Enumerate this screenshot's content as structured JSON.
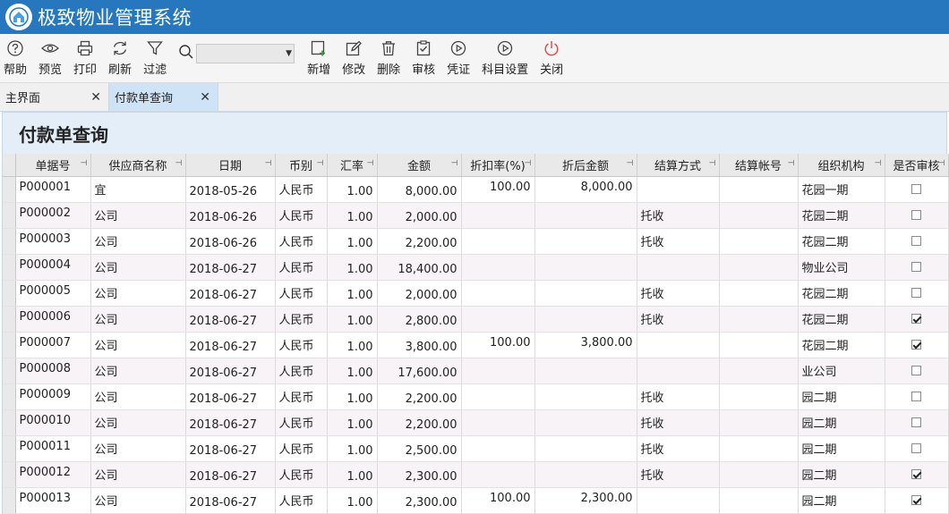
{
  "app": {
    "title": "极致物业管理系统"
  },
  "toolbar": {
    "buttons": [
      {
        "id": "help",
        "label": "帮助",
        "icon": "help-icon"
      },
      {
        "id": "preview",
        "label": "预览",
        "icon": "eye-icon"
      },
      {
        "id": "print",
        "label": "打印",
        "icon": "printer-icon"
      },
      {
        "id": "refresh",
        "label": "刷新",
        "icon": "refresh-icon"
      },
      {
        "id": "filter",
        "label": "过滤",
        "icon": "funnel-icon"
      }
    ],
    "search": {
      "value": ""
    },
    "buttons2": [
      {
        "id": "add",
        "label": "新增",
        "icon": "add-doc-icon"
      },
      {
        "id": "edit",
        "label": "修改",
        "icon": "pencil-icon"
      },
      {
        "id": "delete",
        "label": "删除",
        "icon": "trash-icon"
      },
      {
        "id": "audit",
        "label": "审核",
        "icon": "clipboard-check-icon"
      },
      {
        "id": "voucher",
        "label": "凭证",
        "icon": "play-circle-icon"
      },
      {
        "id": "subject",
        "label": "科目设置",
        "icon": "play-circle-icon"
      },
      {
        "id": "close",
        "label": "关闭",
        "icon": "power-icon"
      }
    ]
  },
  "tabs": [
    {
      "label": "主界面",
      "active": false
    },
    {
      "label": "付款单查询",
      "active": true
    }
  ],
  "page": {
    "title": "付款单查询"
  },
  "colors": {
    "titlebar": "#2677bd",
    "active_tab": "#cfe3f7",
    "page_header": "#e3eef8",
    "close_icon": "#e05050"
  },
  "table": {
    "columns": [
      "单据号",
      "供应商名称",
      "日期",
      "币别",
      "汇率",
      "金额",
      "折扣率(%)",
      "折后金额",
      "结算方式",
      "结算帐号",
      "组织机构",
      "是否审核"
    ],
    "rows": [
      {
        "no": "P000001",
        "supplier": "宜",
        "date": "2018-05-26",
        "currency": "人民币",
        "rate": "1.00",
        "amount": "8,000.00",
        "discount": "100.00",
        "net": "8,000.00",
        "method": "",
        "account": "",
        "org": "花园一期",
        "audited": false
      },
      {
        "no": "P000002",
        "supplier": "公司",
        "date": "2018-06-26",
        "currency": "人民币",
        "rate": "1.00",
        "amount": "2,000.00",
        "discount": "",
        "net": "",
        "method": "托收",
        "account": "",
        "org": "花园二期",
        "audited": false
      },
      {
        "no": "P000003",
        "supplier": "公司",
        "date": "2018-06-26",
        "currency": "人民币",
        "rate": "1.00",
        "amount": "2,200.00",
        "discount": "",
        "net": "",
        "method": "托收",
        "account": "",
        "org": "花园二期",
        "audited": false
      },
      {
        "no": "P000004",
        "supplier": "公司",
        "date": "2018-06-27",
        "currency": "人民币",
        "rate": "1.00",
        "amount": "18,400.00",
        "discount": "",
        "net": "",
        "method": "",
        "account": "",
        "org": "物业公司",
        "audited": false
      },
      {
        "no": "P000005",
        "supplier": "公司",
        "date": "2018-06-27",
        "currency": "人民币",
        "rate": "1.00",
        "amount": "2,000.00",
        "discount": "",
        "net": "",
        "method": "托收",
        "account": "",
        "org": "花园二期",
        "audited": false
      },
      {
        "no": "P000006",
        "supplier": "公司",
        "date": "2018-06-27",
        "currency": "人民币",
        "rate": "1.00",
        "amount": "2,800.00",
        "discount": "",
        "net": "",
        "method": "托收",
        "account": "",
        "org": "花园二期",
        "audited": true
      },
      {
        "no": "P000007",
        "supplier": "公司",
        "date": "2018-06-27",
        "currency": "人民币",
        "rate": "1.00",
        "amount": "3,800.00",
        "discount": "100.00",
        "net": "3,800.00",
        "method": "",
        "account": "",
        "org": "花园二期",
        "audited": true
      },
      {
        "no": "P000008",
        "supplier": "公司",
        "date": "2018-06-27",
        "currency": "人民币",
        "rate": "1.00",
        "amount": "17,600.00",
        "discount": "",
        "net": "",
        "method": "",
        "account": "",
        "org": "业公司",
        "audited": false
      },
      {
        "no": "P000009",
        "supplier": "公司",
        "date": "2018-06-27",
        "currency": "人民币",
        "rate": "1.00",
        "amount": "2,200.00",
        "discount": "",
        "net": "",
        "method": "托收",
        "account": "",
        "org": "园二期",
        "audited": false
      },
      {
        "no": "P000010",
        "supplier": "公司",
        "date": "2018-06-27",
        "currency": "人民币",
        "rate": "1.00",
        "amount": "2,200.00",
        "discount": "",
        "net": "",
        "method": "托收",
        "account": "",
        "org": "园二期",
        "audited": false
      },
      {
        "no": "P000011",
        "supplier": "公司",
        "date": "2018-06-27",
        "currency": "人民币",
        "rate": "1.00",
        "amount": "2,500.00",
        "discount": "",
        "net": "",
        "method": "托收",
        "account": "",
        "org": "园二期",
        "audited": false
      },
      {
        "no": "P000012",
        "supplier": "公司",
        "date": "2018-06-27",
        "currency": "人民币",
        "rate": "1.00",
        "amount": "2,300.00",
        "discount": "",
        "net": "",
        "method": "托收",
        "account": "",
        "org": "园二期",
        "audited": true
      },
      {
        "no": "P000013",
        "supplier": "公司",
        "date": "2018-06-27",
        "currency": "人民币",
        "rate": "1.00",
        "amount": "2,300.00",
        "discount": "100.00",
        "net": "2,300.00",
        "method": "",
        "account": "",
        "org": "园二期",
        "audited": true
      }
    ]
  }
}
